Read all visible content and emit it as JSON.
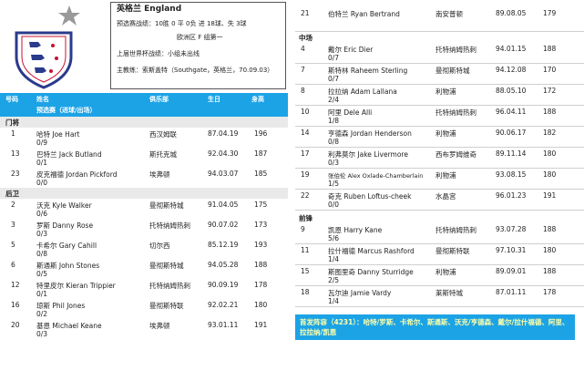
{
  "header": {
    "team_name": "英格兰  England",
    "qualify": "预选赛战绩：10胜 0 平 0负         进 18球、失 3球",
    "group": "欧洲区 F 组第一",
    "last_wc": "上届世界杯战绩：小组未出线",
    "coach": "主教练：索斯盖特（Southgate，英格兰，70.09.03）"
  },
  "columns": {
    "num": "号码",
    "name": "姓名",
    "stats": "预选赛（进球/出场）",
    "club": "俱乐部",
    "dob": "生日",
    "height": "身高"
  },
  "sections": {
    "gk": "门将",
    "df": "后卫",
    "mf": "中场",
    "fw": "前锋"
  },
  "goalkeepers": [
    {
      "num": "1",
      "name": "哈特 Joe Hart",
      "stat": "0/9",
      "club": "西汉姆联",
      "dob": "87.04.19",
      "height": "196"
    },
    {
      "num": "13",
      "name": "巴特兰 Jack Butland",
      "stat": "0/1",
      "club": "斯托克城",
      "dob": "92.04.30",
      "height": "187"
    },
    {
      "num": "23",
      "name": "皮克福德 Jordan Pickford",
      "stat": "0/0",
      "club": "埃弗顿",
      "dob": "94.03.07",
      "height": "185"
    }
  ],
  "defenders": [
    {
      "num": "2",
      "name": "沃克 Kyle Walker",
      "stat": "0/6",
      "club": "曼彻斯特城",
      "dob": "91.04.05",
      "height": "175"
    },
    {
      "num": "3",
      "name": "罗斯 Danny Rose",
      "stat": "0/3",
      "club": "托特纳姆热刺",
      "dob": "90.07.02",
      "height": "173"
    },
    {
      "num": "5",
      "name": "卡希尔 Gary Cahill",
      "stat": "0/8",
      "club": "切尔西",
      "dob": "85.12.19",
      "height": "193"
    },
    {
      "num": "6",
      "name": "斯通斯 John Stones",
      "stat": "0/5",
      "club": "曼彻斯特城",
      "dob": "94.05.28",
      "height": "188"
    },
    {
      "num": "12",
      "name": "特里皮尔 Kieran Trippier",
      "stat": "0/1",
      "club": "托特纳姆热刺",
      "dob": "90.09.19",
      "height": "178"
    },
    {
      "num": "16",
      "name": "琼斯 Phil Jones",
      "stat": "0/2",
      "club": "曼彻斯特联",
      "dob": "92.02.21",
      "height": "180"
    },
    {
      "num": "20",
      "name": "基恩 Michael Keane",
      "stat": "0/3",
      "club": "埃弗顿",
      "dob": "93.01.11",
      "height": "191"
    }
  ],
  "defenders_right": [
    {
      "num": "21",
      "name": "伯特兰 Ryan Bertrand",
      "stat": "",
      "club": "南安普顿",
      "dob": "89.08.05",
      "height": "179"
    }
  ],
  "midfielders": [
    {
      "num": "4",
      "name": "戴尔 Eric Dier",
      "stat": "0/7",
      "club": "托特纳姆热刺",
      "dob": "94.01.15",
      "height": "188"
    },
    {
      "num": "7",
      "name": "斯特林 Raheem Sterling",
      "stat": "0/7",
      "club": "曼彻斯特城",
      "dob": "94.12.08",
      "height": "170"
    },
    {
      "num": "8",
      "name": "拉拉纳 Adam Lallana",
      "stat": "2/4",
      "club": "利物浦",
      "dob": "88.05.10",
      "height": "172"
    },
    {
      "num": "10",
      "name": "阿里 Dele Alli",
      "stat": "1/8",
      "club": "托特纳姆热刺",
      "dob": "96.04.11",
      "height": "188"
    },
    {
      "num": "14",
      "name": "亨德森 Jordan Henderson",
      "stat": "0/8",
      "club": "利物浦",
      "dob": "90.06.17",
      "height": "182"
    },
    {
      "num": "17",
      "name": "利弗莫尔 Jake Livermore",
      "stat": "0/3",
      "club": "西布罗姆维奇",
      "dob": "89.11.14",
      "height": "180"
    },
    {
      "num": "19",
      "name": "张伯伦 Alex Oxlade-Chamberlain",
      "stat": "1/5",
      "club": "利物浦",
      "dob": "93.08.15",
      "height": "180"
    },
    {
      "num": "22",
      "name": "奇克 Ruben Loftus-cheek",
      "stat": "0/0",
      "club": "水晶宫",
      "dob": "96.01.23",
      "height": "191"
    }
  ],
  "forwards": [
    {
      "num": "9",
      "name": "凯恩 Harry Kane",
      "stat": "5/6",
      "club": "托特纳姆热刺",
      "dob": "93.07.28",
      "height": "188"
    },
    {
      "num": "11",
      "name": "拉什福德 Marcus Rashford",
      "stat": "1/4",
      "club": "曼彻斯特联",
      "dob": "97.10.31",
      "height": "180"
    },
    {
      "num": "15",
      "name": "斯图里奇 Danny Sturridge",
      "stat": "2/5",
      "club": "利物浦",
      "dob": "89.09.01",
      "height": "188"
    },
    {
      "num": "18",
      "name": "瓦尔迪 Jamie Vardy",
      "stat": "1/4",
      "club": "莱斯特城",
      "dob": "87.01.11",
      "height": "178"
    }
  ],
  "lineup_note": "首发阵容（4231）：哈特/罗斯、卡希尔、斯通斯、沃克/亨德森、戴尔/拉什福德、阿里、拉拉纳/凯恩",
  "colors": {
    "header_blue": "#1ca3e6",
    "note_text": "#ffffaa"
  }
}
